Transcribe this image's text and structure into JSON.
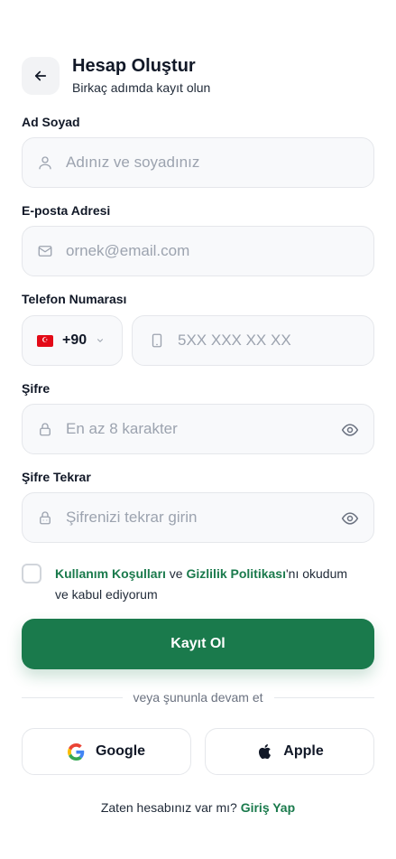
{
  "header": {
    "title": "Hesap Oluştur",
    "subtitle": "Birkaç adımda kayıt olun",
    "back_icon": "arrow-left-icon"
  },
  "form": {
    "name": {
      "label": "Ad Soyad",
      "placeholder": "Adınız ve soyadınız",
      "value": "",
      "icon": "user-icon"
    },
    "email": {
      "label": "E-posta Adresi",
      "placeholder": "ornek@email.com",
      "value": "",
      "icon": "mail-icon"
    },
    "phone": {
      "label": "Telefon Numarası",
      "country_code": "+90",
      "flag_icon": "turkey-flag-icon",
      "placeholder": "5XX XXX XX XX",
      "value": "",
      "icon": "phone-icon"
    },
    "password": {
      "label": "Şifre",
      "placeholder": "En az 8 karakter",
      "value": "",
      "icon": "lock-icon"
    },
    "password_confirm": {
      "label": "Şifre Tekrar",
      "placeholder": "Şifrenizi tekrar girin",
      "value": "",
      "icon": "lock-icon"
    }
  },
  "terms": {
    "checked": false,
    "link1": "Kullanım Koşulları",
    "between": " ve ",
    "link2": "Gizlilik Politikası",
    "rest": "'nı okudum ve kabul ediyorum"
  },
  "submit_label": "Kayıt Ol",
  "divider_text": "veya şununla devam et",
  "social": {
    "google_label": "Google",
    "apple_label": "Apple"
  },
  "footer": {
    "text": "Zaten hesabınız var mı? ",
    "link": "Giriş Yap"
  },
  "colors": {
    "primary": "#1a7a4c",
    "field_bg": "#f8f9fb",
    "border": "#e5e7eb",
    "placeholder": "#9ca3af"
  }
}
